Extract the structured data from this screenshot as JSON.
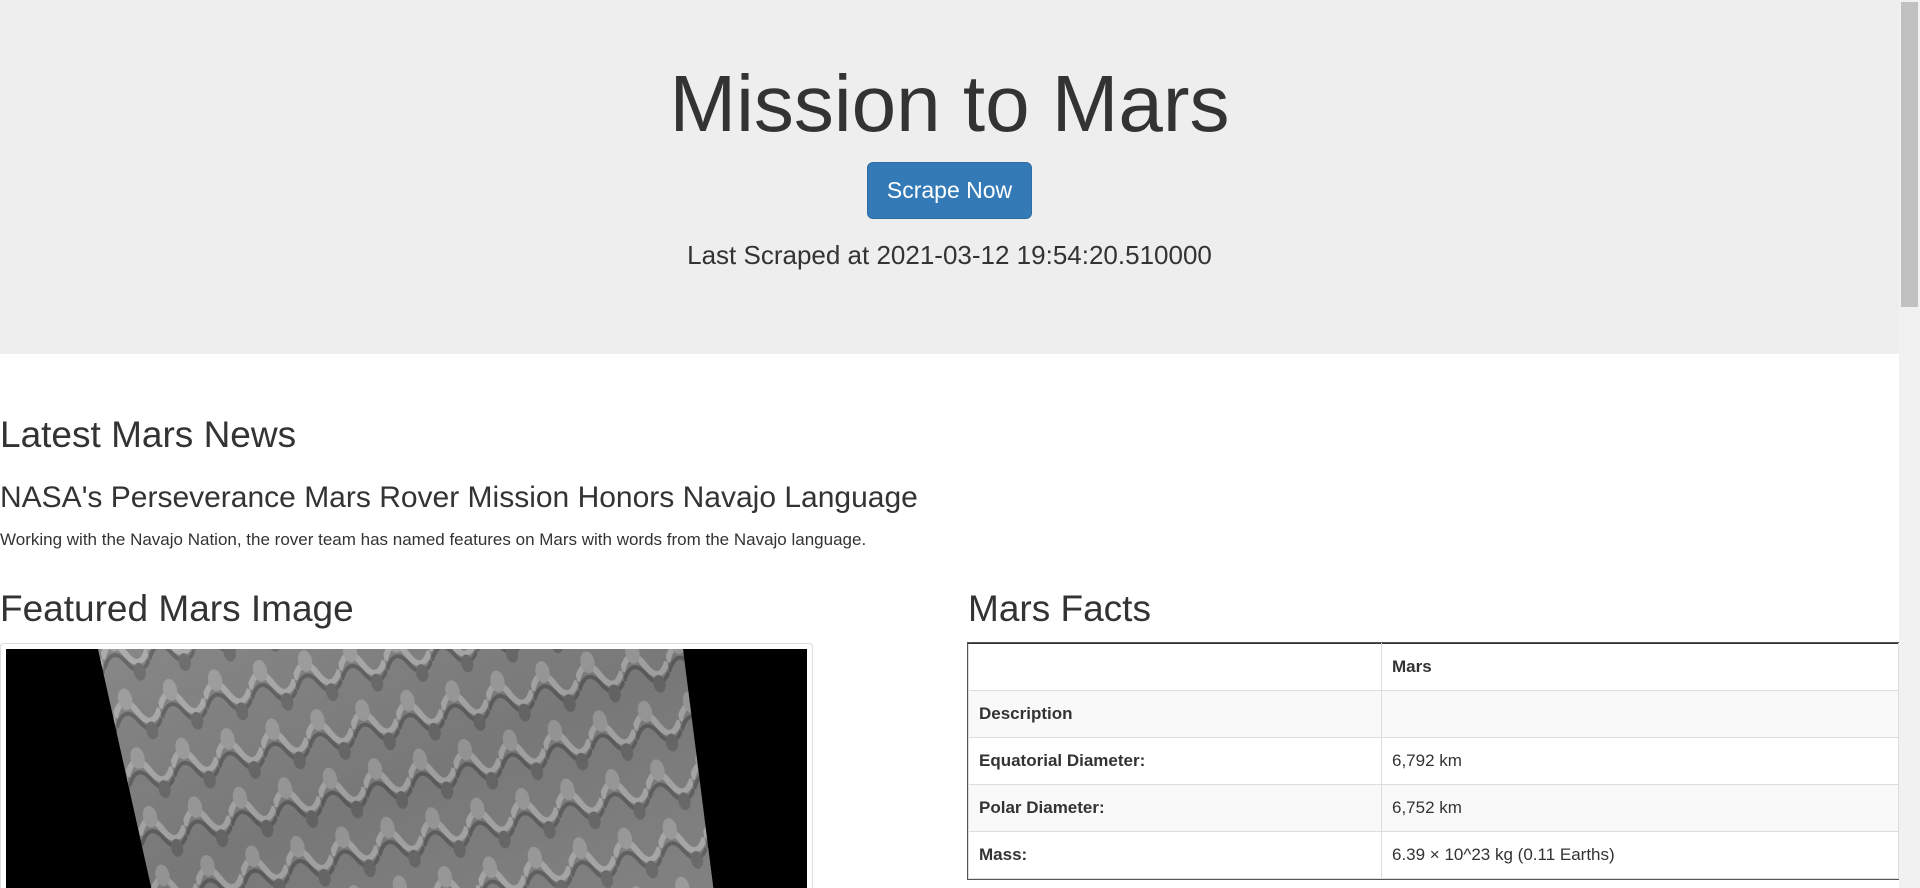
{
  "header": {
    "title": "Mission to Mars",
    "scrape_button": "Scrape Now",
    "last_scraped": "Last Scraped at 2021-03-12 19:54:20.510000"
  },
  "news": {
    "heading": "Latest Mars News",
    "title": "NASA's Perseverance Mars Rover Mission Honors Navajo Language",
    "teaser": "Working with the Navajo Nation, the rover team has named features on Mars with words from the Navajo language."
  },
  "featured_image": {
    "heading": "Featured Mars Image"
  },
  "facts": {
    "heading": "Mars Facts",
    "header_col": "Mars",
    "rows": [
      {
        "label": "Description",
        "value": ""
      },
      {
        "label": "Equatorial Diameter:",
        "value": "6,792 km"
      },
      {
        "label": "Polar Diameter:",
        "value": "6,752 km"
      },
      {
        "label": "Mass:",
        "value": "6.39 × 10^23 kg (0.11 Earths)"
      }
    ]
  }
}
